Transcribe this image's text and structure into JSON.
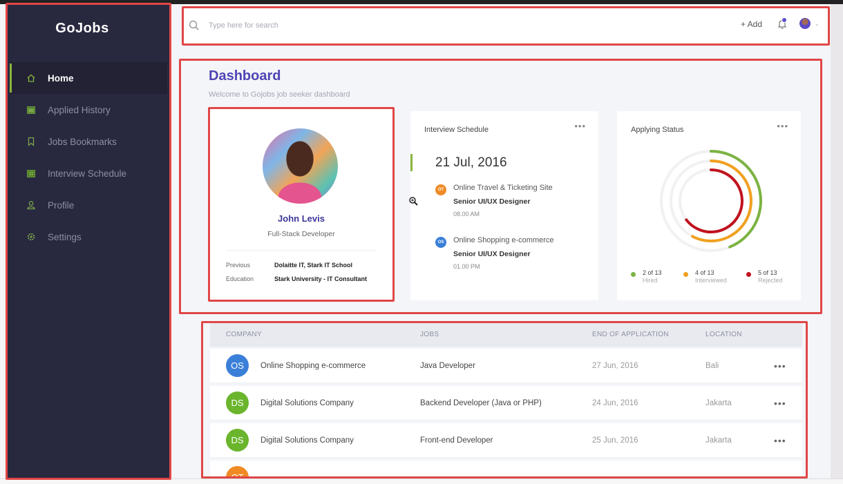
{
  "app": {
    "logo": "GoJobs"
  },
  "sidebar": {
    "items": [
      {
        "label": "Home",
        "icon": "home-icon",
        "active": true
      },
      {
        "label": "Applied History",
        "icon": "calendar-icon",
        "active": false
      },
      {
        "label": "Jobs Bookmarks",
        "icon": "bookmark-icon",
        "active": false
      },
      {
        "label": "Interview Schedule",
        "icon": "schedule-icon",
        "active": false
      },
      {
        "label": "Profile",
        "icon": "user-icon",
        "active": false
      },
      {
        "label": "Settings",
        "icon": "gear-icon",
        "active": false
      }
    ]
  },
  "topbar": {
    "search_placeholder": "Type here for search",
    "add_label": "+ Add",
    "accent": "#5b4fcf"
  },
  "dashboard": {
    "title": "Dashboard",
    "subtitle": "Welcome to Gojobs job seeker dashboard"
  },
  "profile": {
    "name": "John Levis",
    "role": "Full-Stack Developer",
    "previous_label": "Previous",
    "previous_value": "Dolaitte IT, Stark IT School",
    "education_label": "Education",
    "education_value": "Stark University - IT Consultant"
  },
  "schedule": {
    "title": "Interview Schedule",
    "more": "•••",
    "date": "21 Jul, 2016",
    "events": [
      {
        "badge": "OT",
        "color": "#f08a24",
        "company": "Online Travel & Ticketing Site",
        "role": "Senior UI/UX Designer",
        "time": "08.00 AM"
      },
      {
        "badge": "OS",
        "color": "#3a7fd8",
        "company": "Online Shopping e-commerce",
        "role": "Senior UI/UX Designer",
        "time": "01.00 PM"
      }
    ]
  },
  "status": {
    "title": "Applying Status",
    "more": "•••",
    "total": 13,
    "items": [
      {
        "count": 2,
        "label_num": "2 of 13",
        "label": "Hired",
        "color": "#7cb342"
      },
      {
        "count": 4,
        "label_num": "4 of 13",
        "label": "Interviewed",
        "color": "#f0a020"
      },
      {
        "count": 5,
        "label_num": "5 of 13",
        "label": "Rejected",
        "color": "#c0121e"
      }
    ]
  },
  "table": {
    "headers": [
      "COMPANY",
      "JOBS",
      "END OF APPLICATION",
      "LOCATION"
    ],
    "rows": [
      {
        "badge": "OS",
        "color": "#3a7fd8",
        "company": "Online Shopping e-commerce",
        "job": "Java Developer",
        "end": "27 Jun, 2016",
        "location": "Bali",
        "more": "•••"
      },
      {
        "badge": "DS",
        "color": "#6ab52c",
        "company": "Digital Solutions Company",
        "job": "Backend Developer (Java or PHP)",
        "end": "24 Jun, 2016",
        "location": "Jakarta",
        "more": "•••"
      },
      {
        "badge": "DS",
        "color": "#6ab52c",
        "company": "Digital Solutions Company",
        "job": "Front-end Developer",
        "end": "25 Jun, 2016",
        "location": "Jakarta",
        "more": "•••"
      },
      {
        "badge": "OT",
        "color": "#f08a24",
        "company": "",
        "job": "",
        "end": "",
        "location": "",
        "more": ""
      }
    ]
  }
}
